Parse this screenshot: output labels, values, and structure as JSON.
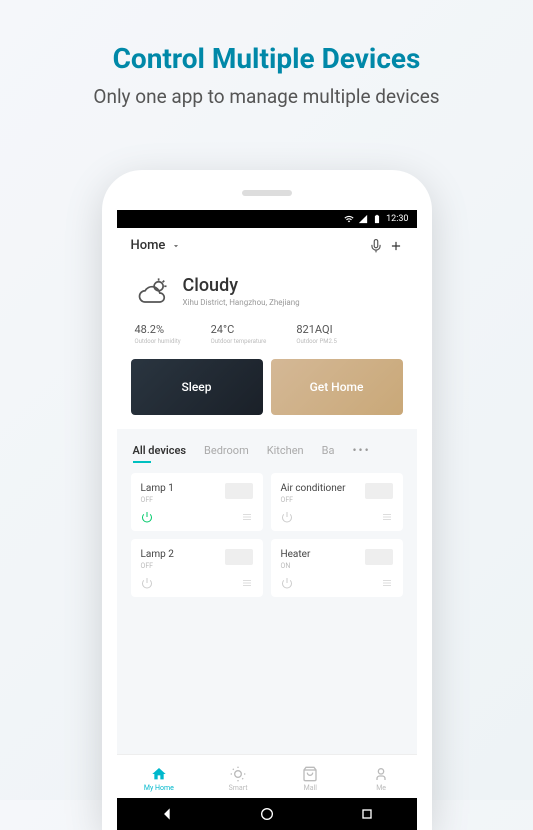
{
  "hero": {
    "title": "Control Multiple Devices",
    "subtitle": "Only one app to manage multiple devices"
  },
  "status_bar": {
    "time": "12:30"
  },
  "header": {
    "title": "Home"
  },
  "weather": {
    "condition": "Cloudy",
    "location": "Xihu District, Hangzhou, Zhejiang",
    "stats": [
      {
        "value": "48.2%",
        "label": "Outdoor humidity"
      },
      {
        "value": "24°C",
        "label": "Outdoor temperature"
      },
      {
        "value": "821AQI",
        "label": "Outdoor PM2.5"
      }
    ]
  },
  "scenes": [
    {
      "label": "Sleep"
    },
    {
      "label": "Get Home"
    }
  ],
  "tabs": [
    {
      "label": "All devices",
      "active": true
    },
    {
      "label": "Bedroom"
    },
    {
      "label": "Kitchen"
    },
    {
      "label": "Ba"
    }
  ],
  "devices": [
    {
      "name": "Lamp 1",
      "state": "OFF",
      "power_on": true
    },
    {
      "name": "Air conditioner",
      "state": "OFF",
      "power_on": false
    },
    {
      "name": "Lamp 2",
      "state": "OFF",
      "power_on": false
    },
    {
      "name": "Heater",
      "state": "ON",
      "power_on": false
    }
  ],
  "nav": [
    {
      "label": "My Home",
      "active": true
    },
    {
      "label": "Smart"
    },
    {
      "label": "Mall"
    },
    {
      "label": "Me"
    }
  ]
}
